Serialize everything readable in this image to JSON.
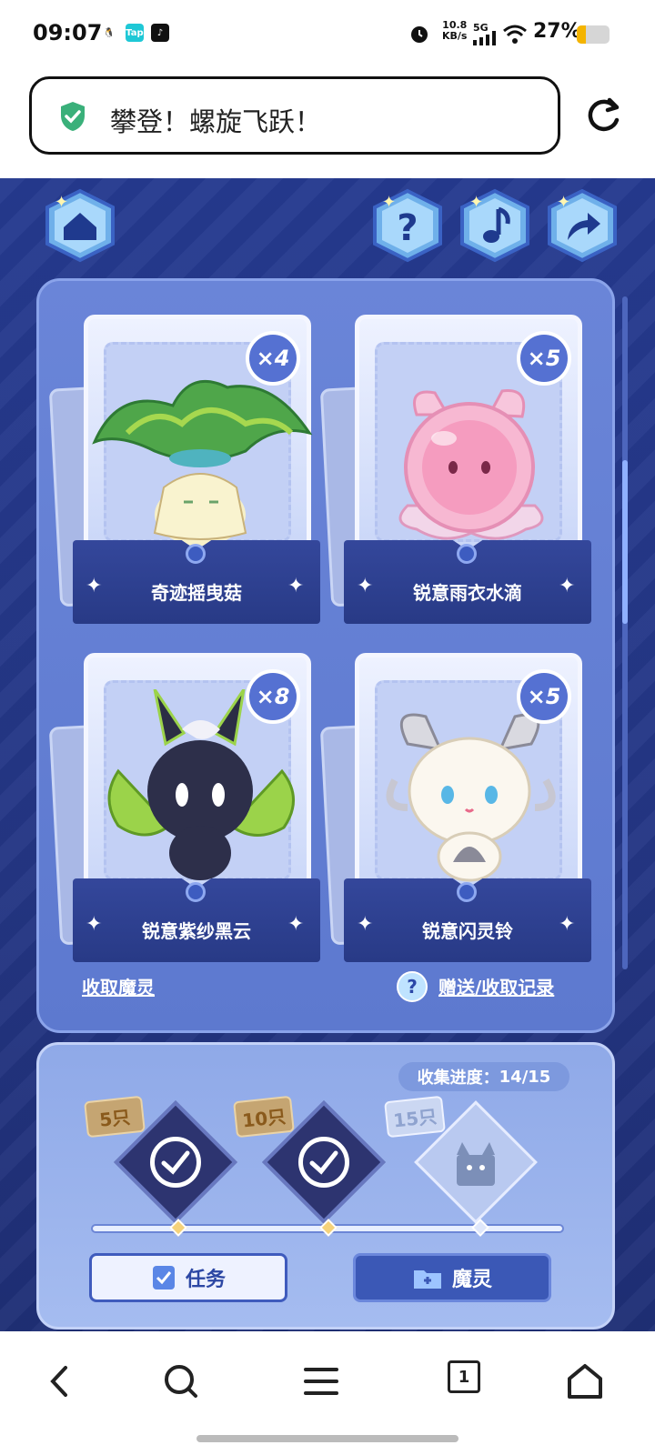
{
  "status_bar": {
    "time": "09:07",
    "net_speed_top": "10.8",
    "net_speed_unit": "KB/s",
    "network": "5G",
    "battery": "27%",
    "app_icons": [
      "qq-icon",
      "taptap-icon",
      "douyin-icon"
    ]
  },
  "url_bar": {
    "title": "攀登！螺旋飞跃！",
    "secure_icon": "shield-check-icon"
  },
  "top_buttons": {
    "home": "home-icon",
    "help": "question-icon",
    "music": "music-note-icon",
    "share": "share-arrow-icon"
  },
  "cards": [
    {
      "name": "奇迹摇曳菇",
      "count": "×4"
    },
    {
      "name": "锐意雨衣水滴",
      "count": "×5"
    },
    {
      "name": "锐意紫纱黑云",
      "count": "×8"
    },
    {
      "name": "锐意闪灵铃",
      "count": "×5"
    }
  ],
  "links": {
    "collect": "收取魔灵",
    "records": "赠送/收取记录",
    "help_mark": "?"
  },
  "collection": {
    "progress_label": "收集进度：",
    "progress_value": "14/15",
    "milestones": [
      {
        "label": "5只",
        "claimed": true
      },
      {
        "label": "10只",
        "claimed": true
      },
      {
        "label": "15只",
        "claimed": false
      }
    ]
  },
  "actions": {
    "task": "任务",
    "spirit": "魔灵"
  },
  "nav": {
    "tab_count": "1"
  },
  "colors": {
    "background": "#243684",
    "panel": "#6a85d8",
    "accent": "#3d5cc0"
  }
}
